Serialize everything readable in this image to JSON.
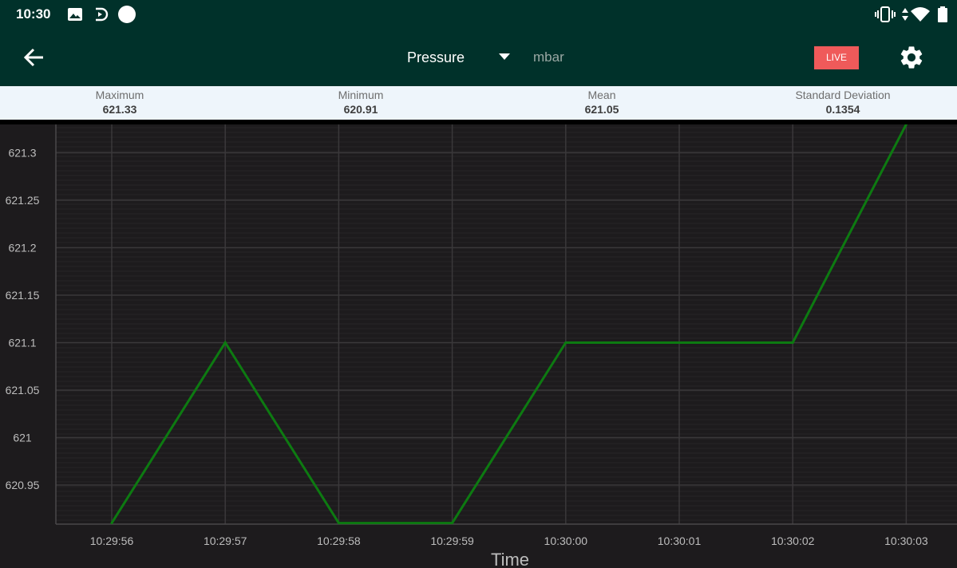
{
  "status": {
    "time": "10:30"
  },
  "toolbar": {
    "sensor_label": "Pressure",
    "unit": "mbar",
    "live_label": "LIVE"
  },
  "stats": [
    {
      "label": "Maximum",
      "value": "621.33"
    },
    {
      "label": "Minimum",
      "value": "620.91"
    },
    {
      "label": "Mean",
      "value": "621.05"
    },
    {
      "label": "Standard Deviation",
      "value": "0.1354"
    }
  ],
  "colors": {
    "header": "#00312a",
    "line": "#0d7a11",
    "live": "#ef5a5a",
    "plot_bg": "#1d1b1d"
  },
  "chart_data": {
    "type": "line",
    "xlabel": "Time",
    "ylabel": "",
    "x": [
      "10:29:56",
      "10:29:57",
      "10:29:58",
      "10:29:59",
      "10:30:00",
      "10:30:01",
      "10:30:02",
      "10:30:03"
    ],
    "series": [
      {
        "values": [
          620.91,
          621.1,
          620.91,
          620.91,
          621.1,
          621.1,
          621.1,
          621.33
        ]
      }
    ],
    "yticks": [
      "621.3",
      "621.25",
      "621.2",
      "621.15",
      "621.1",
      "621.05",
      "621",
      "620.95"
    ],
    "ylim": [
      620.91,
      621.33
    ],
    "grid": true
  }
}
